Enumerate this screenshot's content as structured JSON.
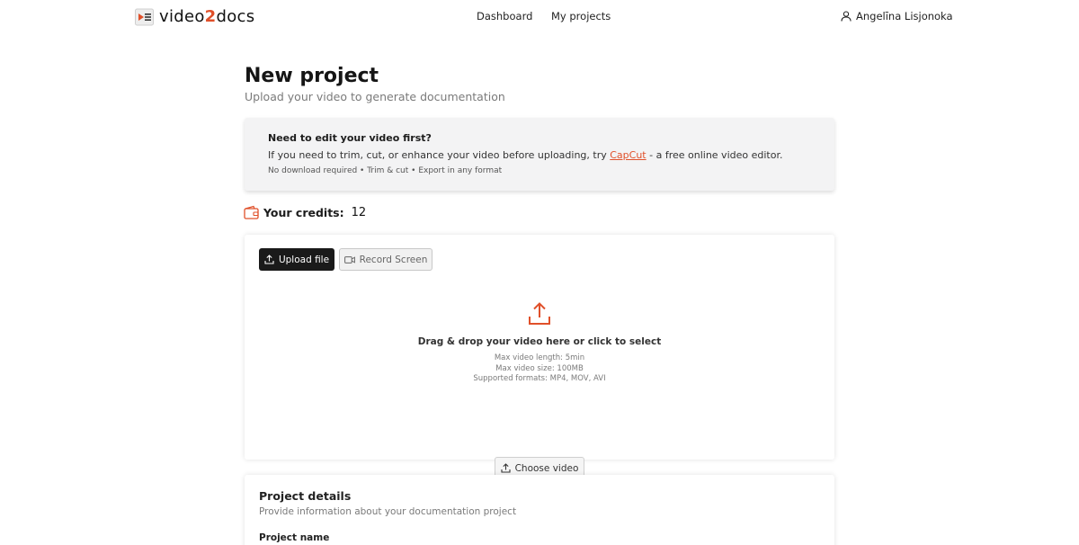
{
  "app": {
    "logo_text_pre": "video",
    "logo_text_num": "2",
    "logo_text_post": "docs",
    "accent_color": "#e0502a"
  },
  "nav": {
    "dashboard": "Dashboard",
    "projects": "My projects",
    "user_name": "Angelīna Lisjonoka",
    "user_icon": "user-icon"
  },
  "page": {
    "title": "New project",
    "subtitle": "Upload your video to generate documentation"
  },
  "banner": {
    "title": "Need to edit your video first?",
    "text_before": "If you need to trim, cut, or enhance your video before uploading, try ",
    "link": "CapCut",
    "text_after": " - a free online video editor.",
    "note": "No download required • Trim & cut • Export in any format"
  },
  "credits": {
    "icon": "wallet-icon",
    "label": "Your credits:",
    "value": "12"
  },
  "upload": {
    "tab_upload": "Upload file",
    "tab_record": "Record Screen",
    "drop_title": "Drag & drop your video here or click to select",
    "max_length": "Max video length: 5min",
    "max_size": "Max video size: 100MB",
    "formats": "Supported formats: MP4, MOV, AVI",
    "choose_button": "Choose video",
    "upload_icon": "upload-icon"
  },
  "details": {
    "title": "Project details",
    "subtitle": "Provide information about your documentation project",
    "project_name_label": "Project name"
  }
}
